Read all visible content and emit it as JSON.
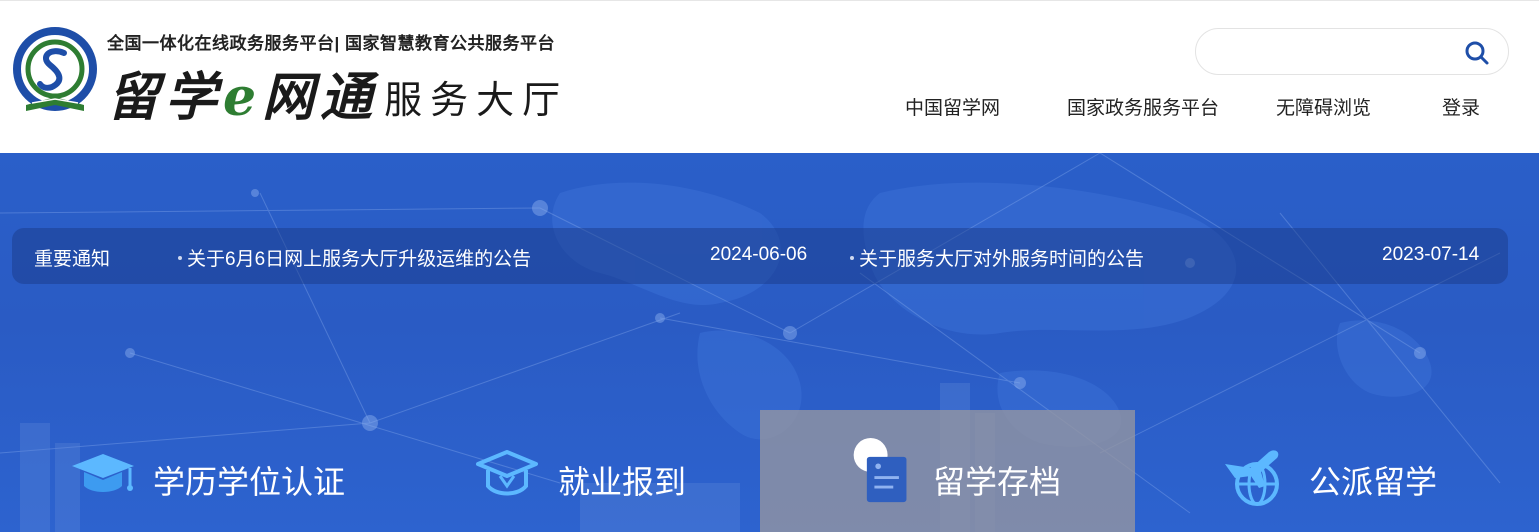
{
  "header": {
    "logo_subtitle": "全国一体化在线政务服务平台| 国家智慧教育公共服务平台",
    "logo_title_calligraphy": "留学",
    "logo_title_e": "e",
    "logo_title_calligraphy2": "网通",
    "logo_title_hall": "服务大厅",
    "search": {
      "placeholder": "",
      "value": ""
    },
    "nav": [
      "中国留学网",
      "国家政务服务平台",
      "无障碍浏览",
      "登录"
    ]
  },
  "notice": {
    "label": "重要通知",
    "items": [
      {
        "title": "关于6月6日网上服务大厅升级运维的公告",
        "date": "2024-06-06"
      },
      {
        "title": "关于服务大厅对外服务时间的公告",
        "date": "2023-07-14"
      }
    ]
  },
  "services": [
    {
      "label": "学历学位认证",
      "icon": "graduation-cap-icon"
    },
    {
      "label": "就业报到",
      "icon": "outline-cap-icon"
    },
    {
      "label": "留学存档",
      "icon": "archive-document-icon"
    },
    {
      "label": "公派留学",
      "icon": "airplane-globe-icon"
    }
  ],
  "colors": {
    "banner": "#2a5fc9",
    "logo_blue": "#1e4ea8",
    "logo_green": "#2e7d32",
    "active_tile": "#96969f"
  }
}
